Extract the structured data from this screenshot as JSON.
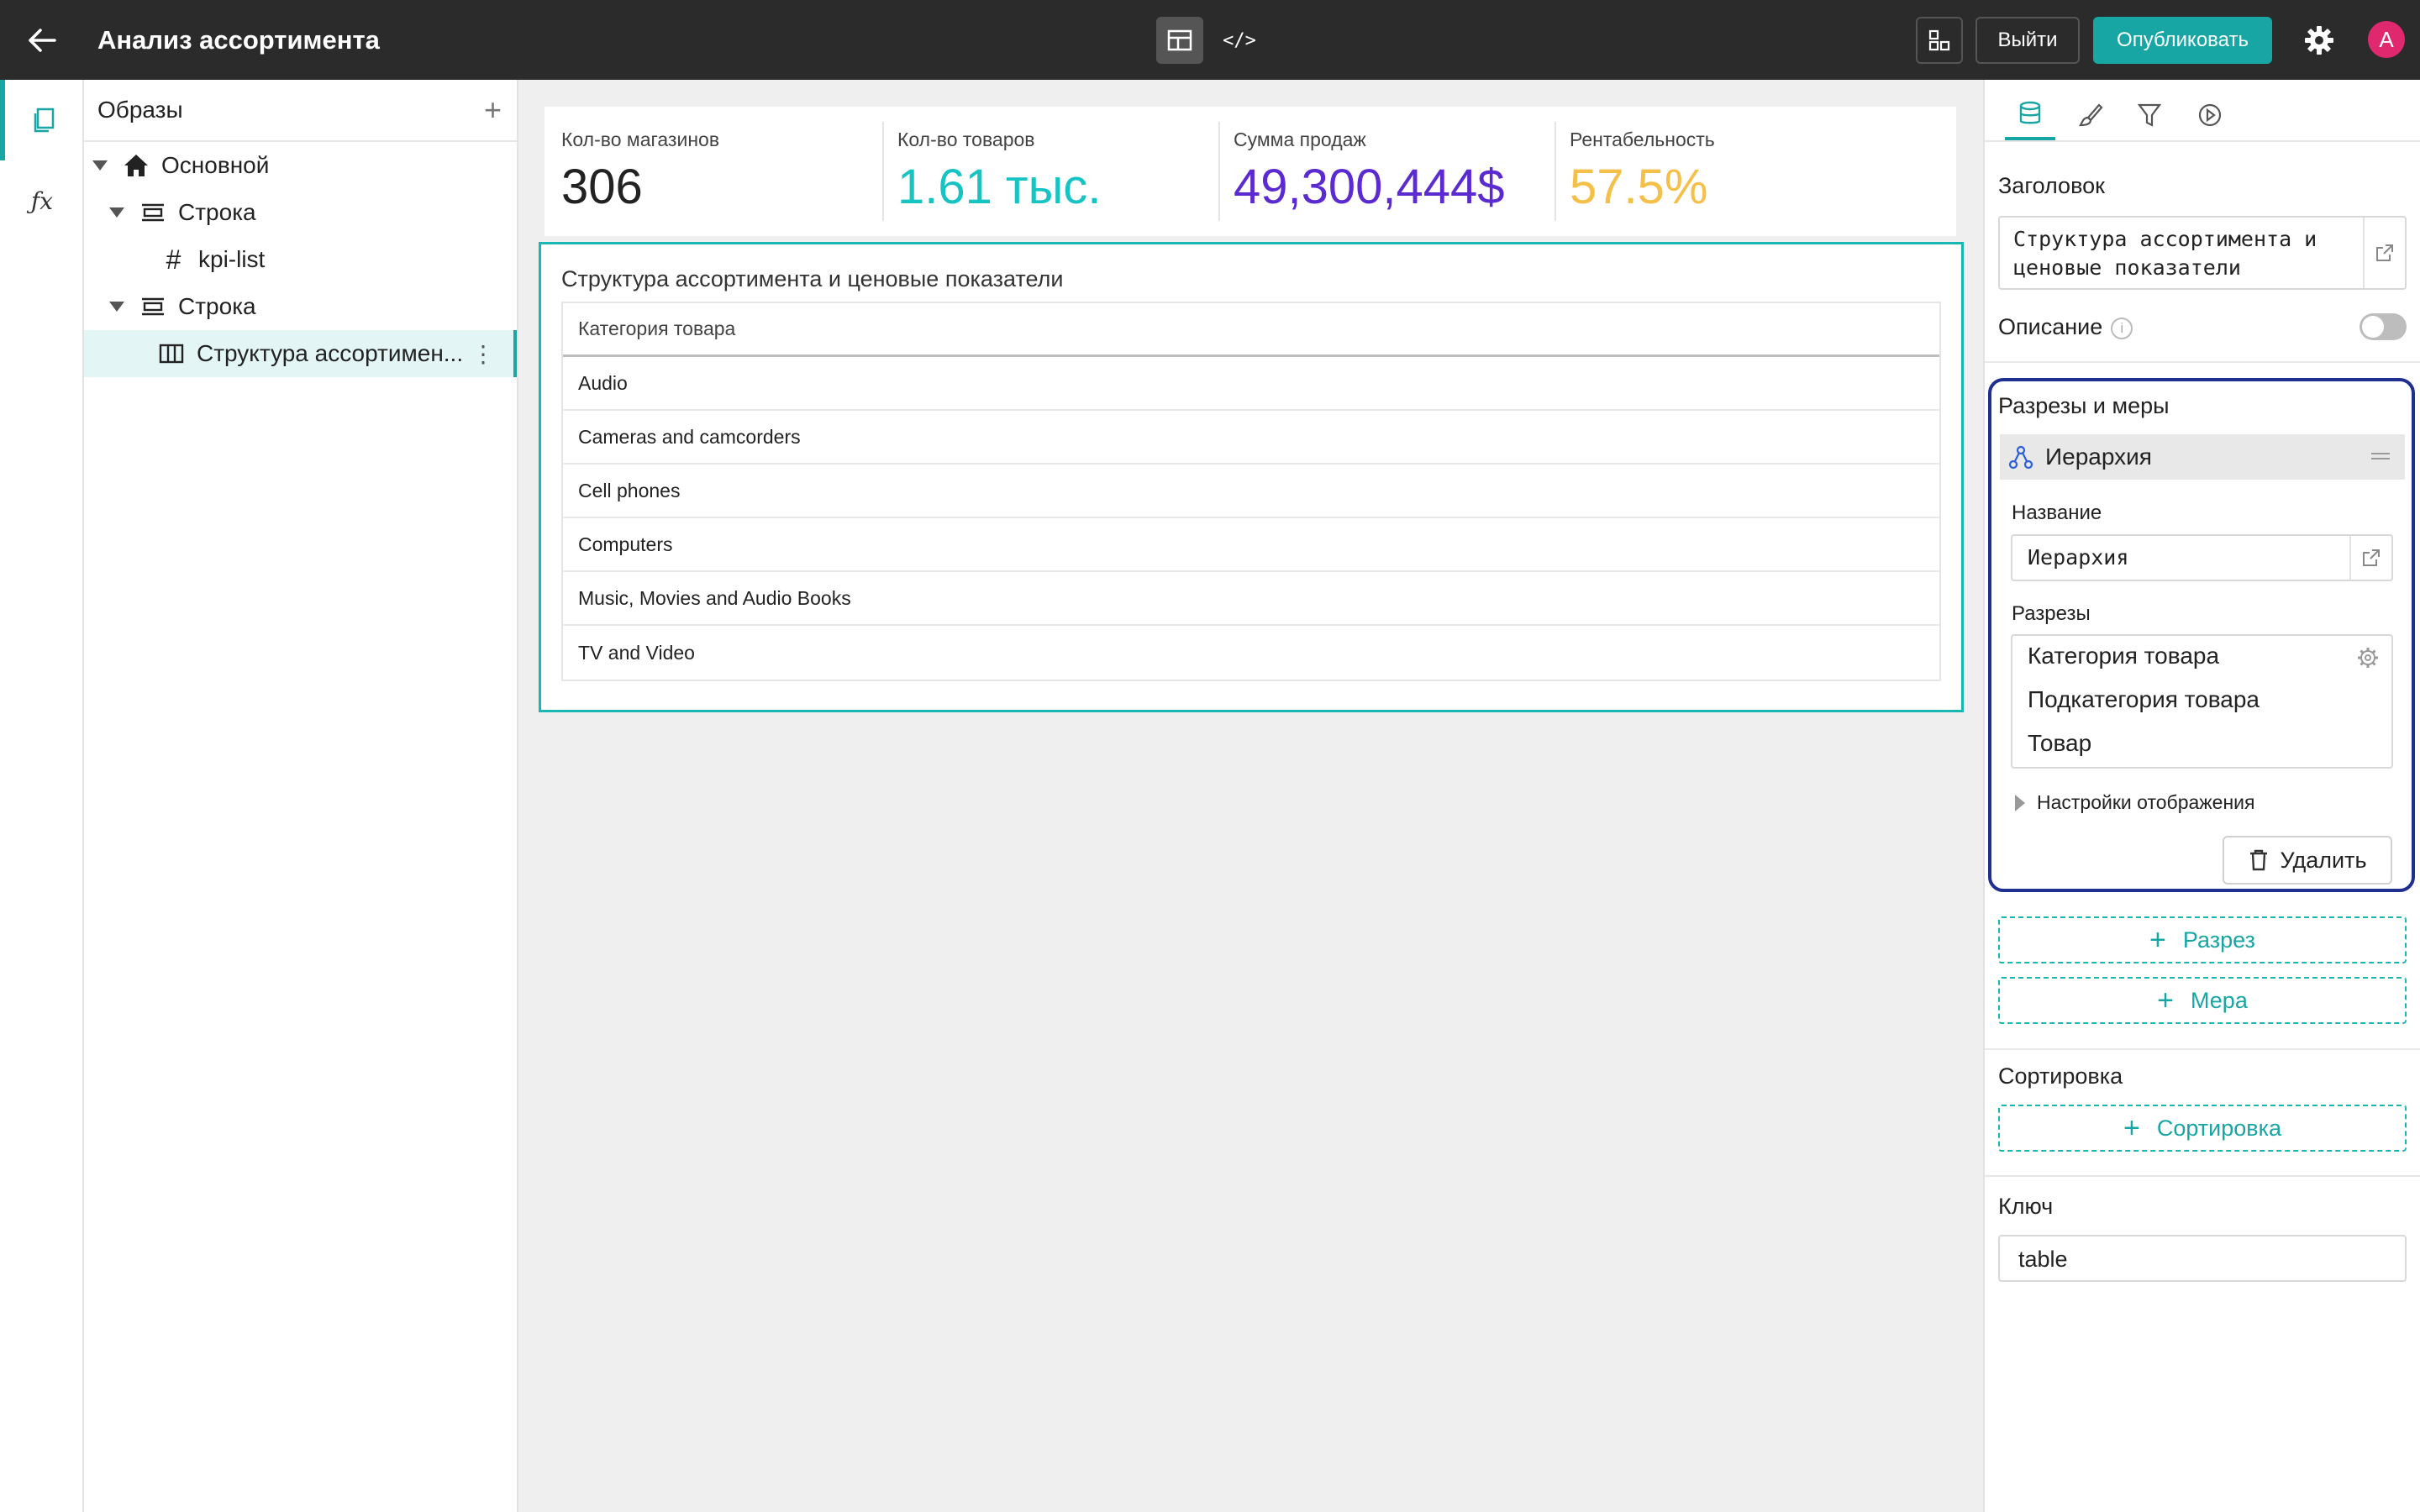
{
  "header": {
    "title": "Анализ ассортимента",
    "exit_label": "Выйти",
    "publish_label": "Опубликовать",
    "avatar_letter": "A",
    "code_mode_glyph": "</>"
  },
  "rail": {
    "fx_label": "ƒx"
  },
  "tree": {
    "title": "Образы",
    "nodes": [
      {
        "label": "Основной",
        "icon": "home-icon"
      },
      {
        "label": "Строка",
        "icon": "row-icon"
      },
      {
        "label": "kpi-list",
        "icon": "hash-icon"
      },
      {
        "label": "Строка",
        "icon": "row-icon"
      },
      {
        "label": "Структура ассортимен...",
        "icon": "table-columns-icon"
      }
    ]
  },
  "kpis": [
    {
      "label": "Кол-во магазинов",
      "value": "306",
      "color": "#222222"
    },
    {
      "label": "Кол-во товаров",
      "value": "1.61 тыс.",
      "color": "#17c3c3"
    },
    {
      "label": "Сумма продаж",
      "value": "49,300,444$",
      "color": "#5b2bd1"
    },
    {
      "label": "Рентабельность",
      "value": "57.5%",
      "color": "#f5c04a"
    }
  ],
  "table": {
    "title": "Структура ассортимента и ценовые показатели",
    "column_header": "Категория товара",
    "rows": [
      "Audio",
      "Cameras and camcorders",
      "Cell phones",
      "Computers",
      "Music, Movies and Audio Books",
      "TV and Video"
    ]
  },
  "props": {
    "heading_label": "Заголовок",
    "heading_value_line1": "Структура ассортимента и",
    "heading_value_line2": "ценовые показатели",
    "description_label": "Описание",
    "cuts_measures_label": "Разрезы и меры",
    "hierarchy_label": "Иерархия",
    "name_label": "Название",
    "name_value": "Иерархия",
    "cuts_label": "Разрезы",
    "cuts": [
      "Категория товара",
      "Подкатегория товара",
      "Товар"
    ],
    "display_settings_label": "Настройки отображения",
    "delete_label": "Удалить",
    "add_cut_label": "Разрез",
    "add_measure_label": "Мера",
    "sort_section_label": "Сортировка",
    "add_sort_label": "Сортировка",
    "key_label": "Ключ",
    "key_value": "table"
  },
  "colors": {
    "accent": "#17a6a3",
    "selection_border": "#1f2f8f",
    "topbar": "#2b2b2b"
  }
}
